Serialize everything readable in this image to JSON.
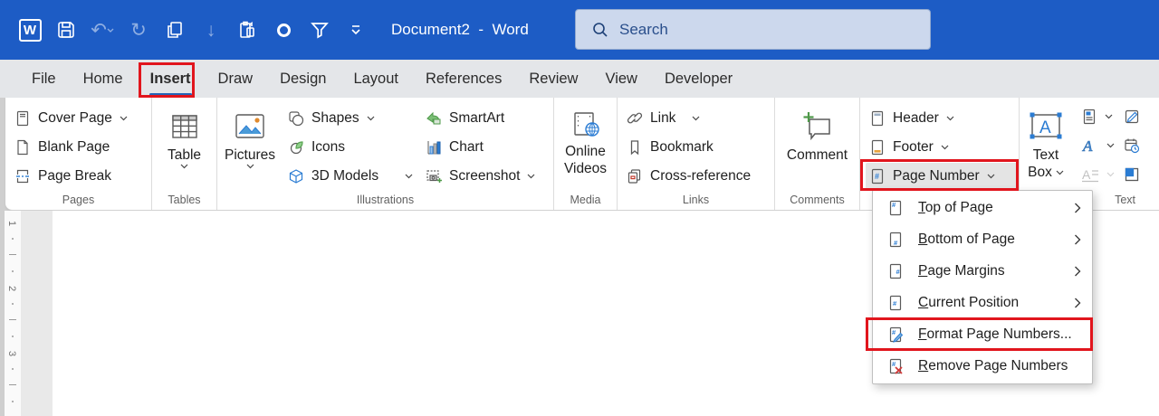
{
  "titlebar": {
    "logo_letter": "W",
    "title": "Document2  -  Word",
    "search_placeholder": "Search"
  },
  "tabs": [
    {
      "label": "File"
    },
    {
      "label": "Home"
    },
    {
      "label": "Insert",
      "active": true
    },
    {
      "label": "Draw"
    },
    {
      "label": "Design"
    },
    {
      "label": "Layout"
    },
    {
      "label": "References"
    },
    {
      "label": "Review"
    },
    {
      "label": "View"
    },
    {
      "label": "Developer"
    }
  ],
  "ribbon": {
    "pages": {
      "label": "Pages",
      "items": [
        {
          "label": "Cover Page"
        },
        {
          "label": "Blank Page"
        },
        {
          "label": "Page Break"
        }
      ]
    },
    "tables": {
      "label": "Tables",
      "button": "Table"
    },
    "illustrations": {
      "label": "Illustrations",
      "pictures": "Pictures",
      "col1": [
        {
          "label": "Shapes"
        },
        {
          "label": "Icons"
        },
        {
          "label": "3D Models"
        }
      ],
      "col2": [
        {
          "label": "SmartArt"
        },
        {
          "label": "Chart"
        },
        {
          "label": "Screenshot"
        }
      ]
    },
    "media": {
      "label": "Media",
      "line1": "Online",
      "line2": "Videos"
    },
    "links": {
      "label": "Links",
      "items": [
        {
          "label": "Link"
        },
        {
          "label": "Bookmark"
        },
        {
          "label": "Cross-reference"
        }
      ]
    },
    "comments": {
      "label": "Comments",
      "button": "Comment"
    },
    "header_footer": {
      "items": [
        {
          "label": "Header"
        },
        {
          "label": "Footer"
        },
        {
          "label": "Page Number"
        }
      ]
    },
    "text": {
      "label": "Text",
      "textbox_line1": "Text",
      "textbox_line2": "Box"
    }
  },
  "menu": {
    "items": [
      {
        "key": "T",
        "rest": "op of Page",
        "submenu": true
      },
      {
        "key": "B",
        "rest": "ottom of Page",
        "submenu": true
      },
      {
        "key": "P",
        "rest": "age Margins",
        "submenu": true
      },
      {
        "key": "C",
        "rest": "urrent Position",
        "submenu": true
      },
      {
        "key": "F",
        "rest": "ormat Page Numbers...",
        "submenu": false
      },
      {
        "key": "R",
        "rest": "emove Page Numbers",
        "submenu": false
      }
    ]
  },
  "ruler": {
    "numbers": [
      "1",
      "2",
      "3"
    ]
  },
  "colors": {
    "titlebar_blue": "#1d5cc5",
    "annotation_red": "#e1151d",
    "tab_underline_blue": "#2464b8",
    "icon_blue": "#2b7cd3"
  }
}
